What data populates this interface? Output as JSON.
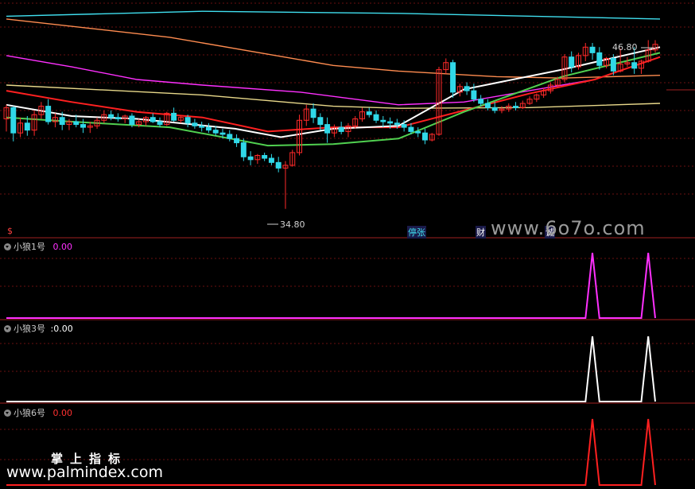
{
  "chart_data": [
    {
      "type": "candlestick",
      "title": "",
      "annotations": {
        "high_label": "46.80",
        "low_label": "34.80"
      },
      "event_markers": [
        "$",
        "停张",
        "财",
        "诚"
      ],
      "candles": [
        [
          41.2,
          42.2,
          40.3,
          42.0
        ],
        [
          42.0,
          42.1,
          39.6,
          40.2
        ],
        [
          40.2,
          41.3,
          39.9,
          40.9
        ],
        [
          40.9,
          41.4,
          40.0,
          40.4
        ],
        [
          40.4,
          41.8,
          40.0,
          41.5
        ],
        [
          41.5,
          42.4,
          41.2,
          42.1
        ],
        [
          42.1,
          42.6,
          40.8,
          41.0
        ],
        [
          41.0,
          41.6,
          40.6,
          41.3
        ],
        [
          41.3,
          41.7,
          40.4,
          40.8
        ],
        [
          40.8,
          41.2,
          40.4,
          41.0
        ],
        [
          41.0,
          41.5,
          40.6,
          40.8
        ],
        [
          40.8,
          41.2,
          40.2,
          40.6
        ],
        [
          40.6,
          41.0,
          40.2,
          40.7
        ],
        [
          40.7,
          41.3,
          40.5,
          41.1
        ],
        [
          41.1,
          41.8,
          40.9,
          41.5
        ],
        [
          41.5,
          41.8,
          41.1,
          41.3
        ],
        [
          41.3,
          41.6,
          41.0,
          41.2
        ],
        [
          41.2,
          41.5,
          40.9,
          41.4
        ],
        [
          41.4,
          41.6,
          40.6,
          40.8
        ],
        [
          40.8,
          41.2,
          40.6,
          41.0
        ],
        [
          41.0,
          41.4,
          40.7,
          41.3
        ],
        [
          41.3,
          41.6,
          40.9,
          41.0
        ],
        [
          41.0,
          41.3,
          40.6,
          40.8
        ],
        [
          40.8,
          41.7,
          40.7,
          41.6
        ],
        [
          41.6,
          42.0,
          41.0,
          41.1
        ],
        [
          41.1,
          41.4,
          40.9,
          41.3
        ],
        [
          41.3,
          41.5,
          40.6,
          40.9
        ],
        [
          40.9,
          41.2,
          40.5,
          40.7
        ],
        [
          40.7,
          41.0,
          40.3,
          40.6
        ],
        [
          40.6,
          40.9,
          40.2,
          40.4
        ],
        [
          40.4,
          40.7,
          40.0,
          40.2
        ],
        [
          40.2,
          40.5,
          39.8,
          40.1
        ],
        [
          40.1,
          40.4,
          39.6,
          39.8
        ],
        [
          39.8,
          40.1,
          39.2,
          39.5
        ],
        [
          39.5,
          39.8,
          38.2,
          38.5
        ],
        [
          38.5,
          38.9,
          37.9,
          38.3
        ],
        [
          38.3,
          38.7,
          38.0,
          38.6
        ],
        [
          38.6,
          38.8,
          38.2,
          38.4
        ],
        [
          38.4,
          38.7,
          37.9,
          38.1
        ],
        [
          38.1,
          38.5,
          37.4,
          37.7
        ],
        [
          37.7,
          38.2,
          34.8,
          37.9
        ],
        [
          37.9,
          39.0,
          37.8,
          38.8
        ],
        [
          38.8,
          41.5,
          38.6,
          41.1
        ],
        [
          41.1,
          42.2,
          40.7,
          41.9
        ],
        [
          41.9,
          42.3,
          40.9,
          41.3
        ],
        [
          41.3,
          41.6,
          40.4,
          40.8
        ],
        [
          40.8,
          41.3,
          39.5,
          40.2
        ],
        [
          40.2,
          40.8,
          39.9,
          40.6
        ],
        [
          40.6,
          41.0,
          40.1,
          40.3
        ],
        [
          40.3,
          40.9,
          39.9,
          40.7
        ],
        [
          40.7,
          41.4,
          40.5,
          41.2
        ],
        [
          41.2,
          42.0,
          41.0,
          41.7
        ],
        [
          41.7,
          42.0,
          41.3,
          41.5
        ],
        [
          41.5,
          41.8,
          40.9,
          41.1
        ],
        [
          41.1,
          41.4,
          40.6,
          41.0
        ],
        [
          41.0,
          41.3,
          40.5,
          40.9
        ],
        [
          40.9,
          41.2,
          40.5,
          40.8
        ],
        [
          40.8,
          41.1,
          40.3,
          40.6
        ],
        [
          40.6,
          40.9,
          40.1,
          40.3
        ],
        [
          40.3,
          40.6,
          39.9,
          40.2
        ],
        [
          40.2,
          40.5,
          39.4,
          39.7
        ],
        [
          39.7,
          40.2,
          39.6,
          40.1
        ],
        [
          40.1,
          44.9,
          40.0,
          44.7
        ],
        [
          44.7,
          45.5,
          44.4,
          45.2
        ],
        [
          45.2,
          45.4,
          42.7,
          43.1
        ],
        [
          43.1,
          43.7,
          42.8,
          43.5
        ],
        [
          43.5,
          43.8,
          42.9,
          43.2
        ],
        [
          43.2,
          43.7,
          42.4,
          42.6
        ],
        [
          42.6,
          42.9,
          42.1,
          42.3
        ],
        [
          42.3,
          42.6,
          41.8,
          42.0
        ],
        [
          42.0,
          42.4,
          41.6,
          41.8
        ],
        [
          41.8,
          42.1,
          41.6,
          41.9
        ],
        [
          41.9,
          42.3,
          41.7,
          42.1
        ],
        [
          42.1,
          42.4,
          41.8,
          42.0
        ],
        [
          42.0,
          42.5,
          41.9,
          42.3
        ],
        [
          42.3,
          42.8,
          42.2,
          42.6
        ],
        [
          42.6,
          43.0,
          42.4,
          42.9
        ],
        [
          42.9,
          43.4,
          42.7,
          43.2
        ],
        [
          43.2,
          43.8,
          43.0,
          43.6
        ],
        [
          43.6,
          44.2,
          43.4,
          44.0
        ],
        [
          44.0,
          45.8,
          43.8,
          45.6
        ],
        [
          45.6,
          46.0,
          44.5,
          44.9
        ],
        [
          44.9,
          45.9,
          44.7,
          45.7
        ],
        [
          45.7,
          46.6,
          45.3,
          46.3
        ],
        [
          46.3,
          46.6,
          45.4,
          45.9
        ],
        [
          45.9,
          46.3,
          44.7,
          45.0
        ],
        [
          45.0,
          45.6,
          44.8,
          45.5
        ],
        [
          45.5,
          45.8,
          44.3,
          44.6
        ],
        [
          44.6,
          46.2,
          44.5,
          45.1
        ],
        [
          45.1,
          45.6,
          44.9,
          45.2
        ],
        [
          45.2,
          46.3,
          44.4,
          44.8
        ],
        [
          44.8,
          45.4,
          44.4,
          45.3
        ],
        [
          45.3,
          46.8,
          45.2,
          46.1
        ],
        [
          46.1,
          46.8,
          45.9,
          46.5
        ]
      ],
      "moving_averages": [
        {
          "color": "#40e0f0",
          "points": [
            [
              0,
              48.5
            ],
            [
              0.3,
              48.85
            ],
            [
              0.6,
              48.7
            ],
            [
              1,
              48.3
            ]
          ]
        },
        {
          "color": "#ff8c50",
          "points": [
            [
              0,
              48.3
            ],
            [
              0.25,
              47.0
            ],
            [
              0.5,
              45.0
            ],
            [
              0.6,
              44.6
            ],
            [
              0.75,
              44.2
            ],
            [
              0.85,
              44.1
            ],
            [
              1,
              44.3
            ]
          ]
        },
        {
          "color": "#ff30ff",
          "points": [
            [
              0,
              45.7
            ],
            [
              0.1,
              44.9
            ],
            [
              0.2,
              44.0
            ],
            [
              0.3,
              43.6
            ],
            [
              0.45,
              43.1
            ],
            [
              0.6,
              42.2
            ],
            [
              0.7,
              42.4
            ],
            [
              0.8,
              43.2
            ],
            [
              0.9,
              44.0
            ],
            [
              1,
              45.6
            ]
          ]
        },
        {
          "color": "#e8d88a",
          "points": [
            [
              0,
              43.6
            ],
            [
              0.3,
              42.9
            ],
            [
              0.5,
              42.1
            ],
            [
              0.6,
              41.95
            ],
            [
              0.8,
              42.0
            ],
            [
              1,
              42.3
            ]
          ]
        },
        {
          "color": "#ff2020",
          "points": [
            [
              0,
              43.2
            ],
            [
              0.1,
              42.4
            ],
            [
              0.2,
              41.7
            ],
            [
              0.3,
              41.3
            ],
            [
              0.4,
              40.3
            ],
            [
              0.5,
              40.6
            ],
            [
              0.6,
              40.6
            ],
            [
              0.7,
              41.8
            ],
            [
              0.8,
              43.0
            ],
            [
              0.9,
              44.0
            ],
            [
              1,
              45.6
            ]
          ]
        },
        {
          "color": "#ffffff",
          "points": [
            [
              0,
              42.2
            ],
            [
              0.1,
              41.4
            ],
            [
              0.2,
              41.2
            ],
            [
              0.35,
              40.5
            ],
            [
              0.42,
              39.9
            ],
            [
              0.5,
              40.5
            ],
            [
              0.6,
              40.7
            ],
            [
              0.7,
              43.3
            ],
            [
              0.85,
              44.7
            ],
            [
              1,
              46.3
            ]
          ]
        },
        {
          "color": "#50d050",
          "points": [
            [
              0,
              41.3
            ],
            [
              0.1,
              41.0
            ],
            [
              0.25,
              40.6
            ],
            [
              0.4,
              39.3
            ],
            [
              0.5,
              39.4
            ],
            [
              0.6,
              39.8
            ],
            [
              0.7,
              41.7
            ],
            [
              0.85,
              44.2
            ],
            [
              1,
              45.9
            ]
          ]
        }
      ]
    },
    {
      "type": "line",
      "indicator": "小狼1号",
      "value_label": "0.00",
      "color": "#ff30ff",
      "values": [
        0,
        0,
        0,
        0,
        0,
        0,
        0,
        0,
        0,
        0,
        0,
        0,
        0,
        0,
        0,
        0,
        0,
        0,
        0,
        0,
        0,
        0,
        0,
        0,
        0,
        0,
        0,
        0,
        0,
        0,
        0,
        0,
        0,
        0,
        0,
        0,
        0,
        0,
        0,
        0,
        0,
        0,
        0,
        0,
        0,
        0,
        0,
        0,
        0,
        0,
        0,
        0,
        0,
        0,
        0,
        0,
        0,
        0,
        0,
        0,
        0,
        0,
        0,
        0,
        0,
        0,
        0,
        0,
        0,
        0,
        0,
        0,
        0,
        0,
        0,
        0,
        0,
        0,
        0,
        0,
        0,
        0,
        0,
        0,
        1,
        0,
        0,
        0,
        0,
        0,
        0,
        0,
        1,
        0
      ]
    },
    {
      "type": "line",
      "indicator": "小狼3号",
      "value_label": "0.00",
      "color": "#ffffff",
      "values": [
        0,
        0,
        0,
        0,
        0,
        0,
        0,
        0,
        0,
        0,
        0,
        0,
        0,
        0,
        0,
        0,
        0,
        0,
        0,
        0,
        0,
        0,
        0,
        0,
        0,
        0,
        0,
        0,
        0,
        0,
        0,
        0,
        0,
        0,
        0,
        0,
        0,
        0,
        0,
        0,
        0,
        0,
        0,
        0,
        0,
        0,
        0,
        0,
        0,
        0,
        0,
        0,
        0,
        0,
        0,
        0,
        0,
        0,
        0,
        0,
        0,
        0,
        0,
        0,
        0,
        0,
        0,
        0,
        0,
        0,
        0,
        0,
        0,
        0,
        0,
        0,
        0,
        0,
        0,
        0,
        0,
        0,
        0,
        0,
        1,
        0,
        0,
        0,
        0,
        0,
        0,
        0,
        1,
        0
      ]
    },
    {
      "type": "line",
      "indicator": "小狼6号",
      "value_label": "0.00",
      "color": "#ff2020",
      "values": [
        0,
        0,
        0,
        0,
        0,
        0,
        0,
        0,
        0,
        0,
        0,
        0,
        0,
        0,
        0,
        0,
        0,
        0,
        0,
        0,
        0,
        0,
        0,
        0,
        0,
        0,
        0,
        0,
        0,
        0,
        0,
        0,
        0,
        0,
        0,
        0,
        0,
        0,
        0,
        0,
        0,
        0,
        0,
        0,
        0,
        0,
        0,
        0,
        0,
        0,
        0,
        0,
        0,
        0,
        0,
        0,
        0,
        0,
        0,
        0,
        0,
        0,
        0,
        0,
        0,
        0,
        0,
        0,
        0,
        0,
        0,
        0,
        0,
        0,
        0,
        0,
        0,
        0,
        0,
        0,
        0,
        0,
        0,
        0,
        1,
        0,
        0,
        0,
        0,
        0,
        0,
        0,
        1,
        0
      ]
    }
  ],
  "watermarks": {
    "site1": "www.6o7o.com",
    "brand": "掌上指标",
    "site2": "www.palmindex.com"
  }
}
